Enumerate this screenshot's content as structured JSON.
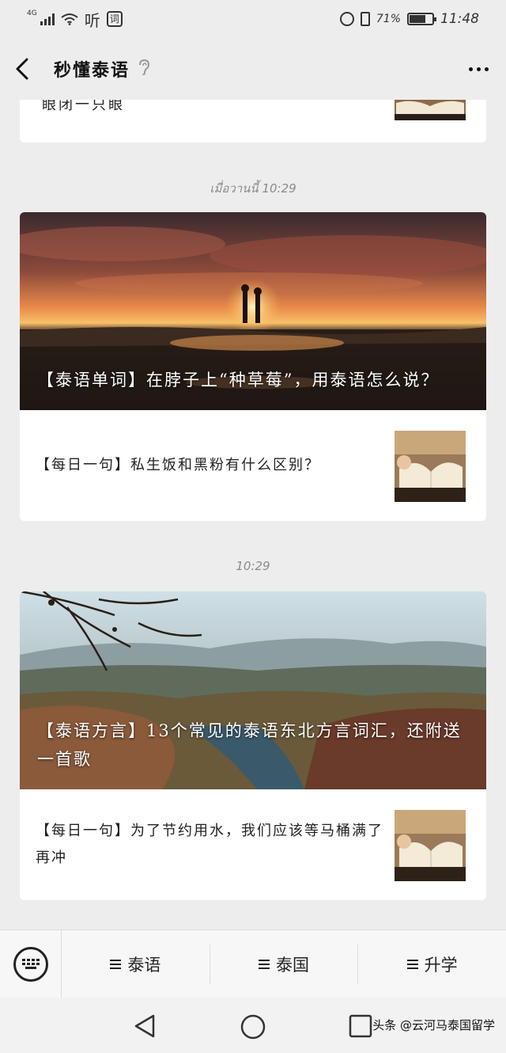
{
  "status_bar": {
    "network": "4G",
    "ting_label": "听",
    "ci_label": "词",
    "battery": "71%",
    "time": "11:48"
  },
  "header": {
    "title": "秒懂泰语"
  },
  "feed": {
    "partial_text": "眼闭一只眼",
    "groups": [
      {
        "timestamp": "เมื่อวานนี้ 10:29",
        "main_title": "【泰语单词】在脖子上“种草莓”，用泰语怎么说？",
        "sub_title": "【每日一句】私生饭和黑粉有什么区别？"
      },
      {
        "timestamp": "10:29",
        "main_title": "【泰语方言】13个常见的泰语东北方言词汇，还附送一首歌",
        "sub_title": "【每日一句】为了节约用水，我们应该等马桶满了再冲"
      }
    ]
  },
  "bottom_menu": {
    "items": [
      "泰语",
      "泰国",
      "升学"
    ]
  },
  "watermark": "头条 @云河马泰国留学",
  "colors": {
    "background": "#ededed",
    "card": "#ffffff",
    "timestamp": "#8a8a8a"
  }
}
